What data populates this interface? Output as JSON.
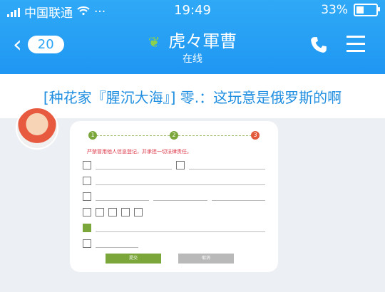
{
  "status": {
    "carrier": "中国联通",
    "time": "19:49",
    "battery_pct": "33%",
    "more": "···"
  },
  "header": {
    "back_count": "20",
    "title": "虎々軍曹",
    "subtitle": "在线"
  },
  "banner": {
    "text": "[种花家『腥沉大海』] 零.：这玩意是俄罗斯的啊"
  },
  "colors": {
    "header_blue": "#2aa4f4",
    "banner_text": "#1f8ee0",
    "form_green": "#7aa63a"
  },
  "form": {
    "steps": [
      "1",
      "2",
      "3"
    ],
    "warning": "严禁冒用他人信息登记，并承担一切法律责任。",
    "button_next": "提交",
    "button_cancel": "取消"
  }
}
